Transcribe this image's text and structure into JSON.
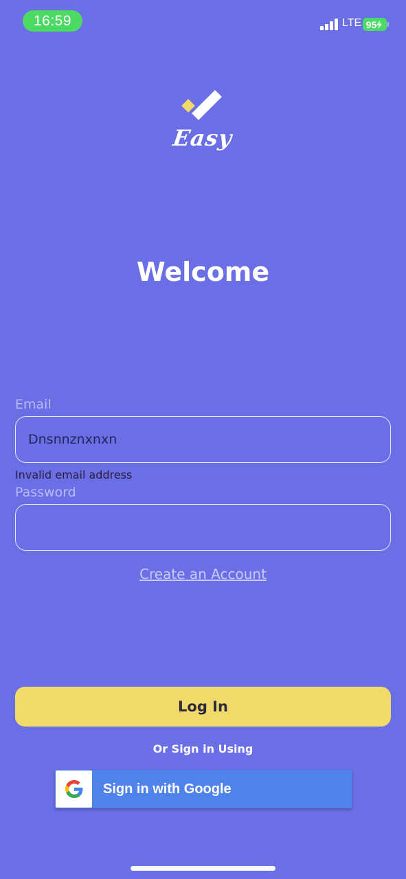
{
  "status_bar": {
    "time": "16:59",
    "network": "LTE",
    "battery": "95"
  },
  "logo": {
    "text": "Easy",
    "icon": "checkmark-logo-icon"
  },
  "welcome_title": "Welcome",
  "email": {
    "label": "Email",
    "value": "Dnsnnznxnxn",
    "error": "Invalid email address"
  },
  "password": {
    "label": "Password",
    "value": ""
  },
  "create_account_link": "Create an Account",
  "login_button": "Log In",
  "or_text": "Or Sign in Using",
  "google_button": {
    "label": "Sign in with Google",
    "icon": "google-icon"
  },
  "colors": {
    "background": "#6a6fe6",
    "login_button": "#f2da6a",
    "google_button": "#4f83e9",
    "status_green": "#4cd964"
  }
}
